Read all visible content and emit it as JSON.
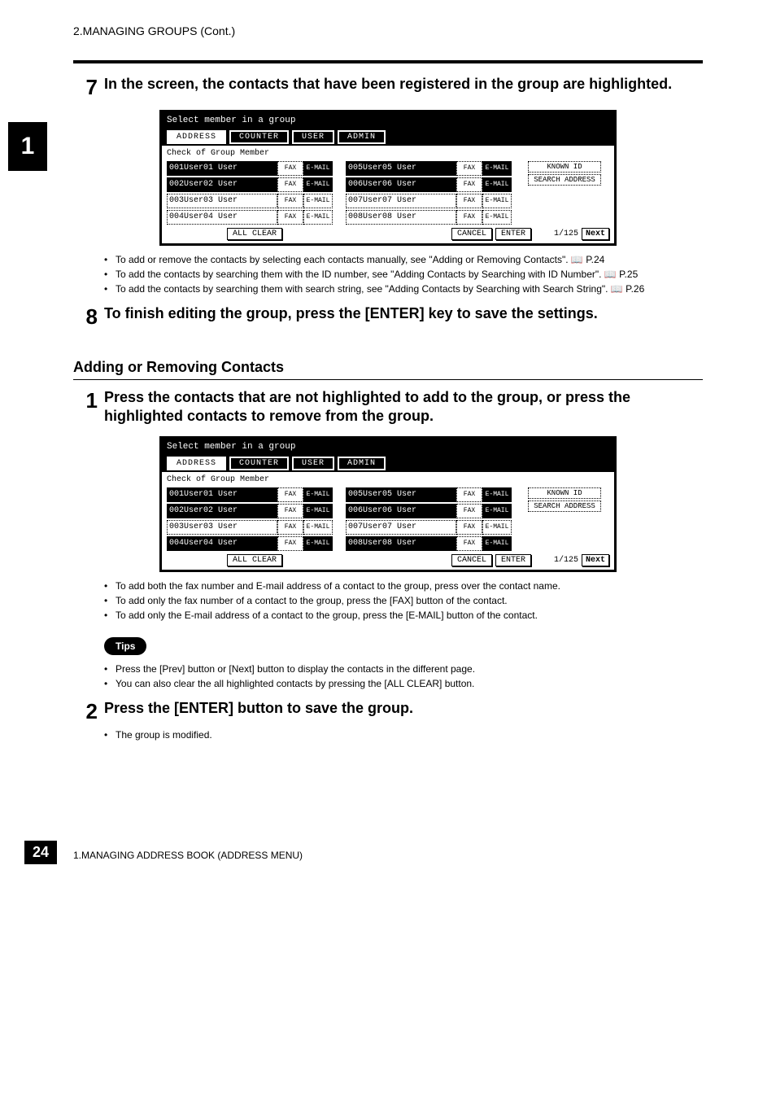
{
  "header": {
    "breadcrumb": "2.MANAGING GROUPS (Cont.)"
  },
  "side_tab": "1",
  "step7": {
    "num": "7",
    "text": "In the screen, the contacts that have been registered in the group are highlighted."
  },
  "step7_bullets": [
    "To add or remove the contacts by selecting each contacts manually, see \"Adding or Removing Contacts\".   📖 P.24",
    "To add the contacts by searching them with the ID number, see \"Adding Contacts by Searching with ID Number\".   📖 P.25",
    "To add the contacts by searching them with search string, see \"Adding Contacts by Searching with Search String\".   📖 P.26"
  ],
  "step8": {
    "num": "8",
    "text": "To finish editing the group, press the [ENTER] key to save the settings."
  },
  "section_heading": "Adding or Removing Contacts",
  "sub_step1": {
    "num": "1",
    "text": "Press the contacts that are not highlighted to add to the group, or press the highlighted contacts to remove from the group."
  },
  "sub_step1_bullets": [
    "To add both the fax number and E-mail address of a contact to the group, press over the contact name.",
    "To add only the fax number of a contact to the group, press the [FAX] button of the contact.",
    "To add only the E-mail address of a contact to the group, press the [E-MAIL] button of the contact."
  ],
  "tips_label": "Tips",
  "tips_bullets": [
    "Press the [Prev] button or [Next] button to display the contacts in the different page.",
    "You can also clear the all highlighted contacts by pressing the [ALL CLEAR] button."
  ],
  "sub_step2": {
    "num": "2",
    "text": "Press the [ENTER] button to save the group."
  },
  "sub_step2_bullets": [
    "The group is modified."
  ],
  "footer": {
    "page_num": "24",
    "caption": "1.MANAGING ADDRESS BOOK (ADDRESS MENU)"
  },
  "device_common": {
    "title": "Select member in a group",
    "tabs": {
      "address": "ADDRESS",
      "counter": "COUNTER",
      "user": "USER",
      "admin": "ADMIN"
    },
    "subhead": "Check of Group Member",
    "fax": "FAX",
    "email": "E-MAIL",
    "known_id": "KNOWN ID",
    "search_address": "SEARCH ADDRESS",
    "all_clear": "ALL CLEAR",
    "cancel": "CANCEL",
    "enter": "ENTER",
    "page": "1/125",
    "next": "Next"
  },
  "device1": {
    "left": [
      {
        "n": "001User01 User",
        "hl_name": true,
        "hl_mail": true
      },
      {
        "n": "002User02 User",
        "hl_name": true,
        "hl_mail": true
      },
      {
        "n": "003User03 User",
        "hl_name": false,
        "hl_mail": false
      },
      {
        "n": "004User04 User",
        "hl_name": false,
        "hl_mail": false
      }
    ],
    "right": [
      {
        "n": "005User05 User",
        "hl_name": true,
        "hl_mail": true
      },
      {
        "n": "006User06 User",
        "hl_name": true,
        "hl_mail": true
      },
      {
        "n": "007User07 User",
        "hl_name": false,
        "hl_mail": false
      },
      {
        "n": "008User08 User",
        "hl_name": false,
        "hl_mail": false
      }
    ]
  },
  "device2": {
    "left": [
      {
        "n": "001User01 User",
        "hl_name": true,
        "hl_mail": true
      },
      {
        "n": "002User02 User",
        "hl_name": true,
        "hl_mail": true
      },
      {
        "n": "003User03 User",
        "hl_name": false,
        "hl_mail": false
      },
      {
        "n": "004User04 User",
        "hl_name": true,
        "hl_mail": true
      }
    ],
    "right": [
      {
        "n": "005User05 User",
        "hl_name": true,
        "hl_mail": true
      },
      {
        "n": "006User06 User",
        "hl_name": true,
        "hl_mail": true
      },
      {
        "n": "007User07 User",
        "hl_name": false,
        "hl_mail": false
      },
      {
        "n": "008User08 User",
        "hl_name": true,
        "hl_mail": true
      }
    ]
  }
}
